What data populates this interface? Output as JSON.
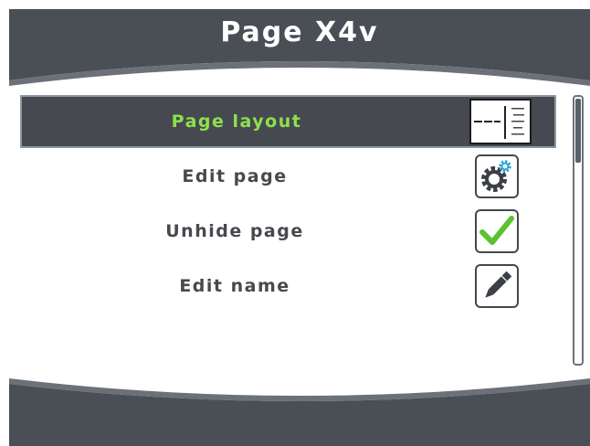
{
  "header": {
    "title": "Page X4v"
  },
  "menu": {
    "items": [
      {
        "label": "Page layout",
        "icon": "page-layout-thumbnail-icon",
        "selected": true
      },
      {
        "label": "Edit page",
        "icon": "gears-icon",
        "selected": false
      },
      {
        "label": "Unhide page",
        "icon": "checkmark-icon",
        "selected": false
      },
      {
        "label": "Edit name",
        "icon": "pen-icon",
        "selected": false
      }
    ]
  },
  "scrollbar": {
    "position": 0.0
  },
  "colors": {
    "bar_dark": "#4a4e55",
    "bar_band": "#6b7079",
    "selected_bg": "#464a50",
    "selected_text": "#8ee04e",
    "label_text": "#46494e",
    "check_green": "#5cc22e",
    "gear_blue": "#2aa6d8"
  }
}
